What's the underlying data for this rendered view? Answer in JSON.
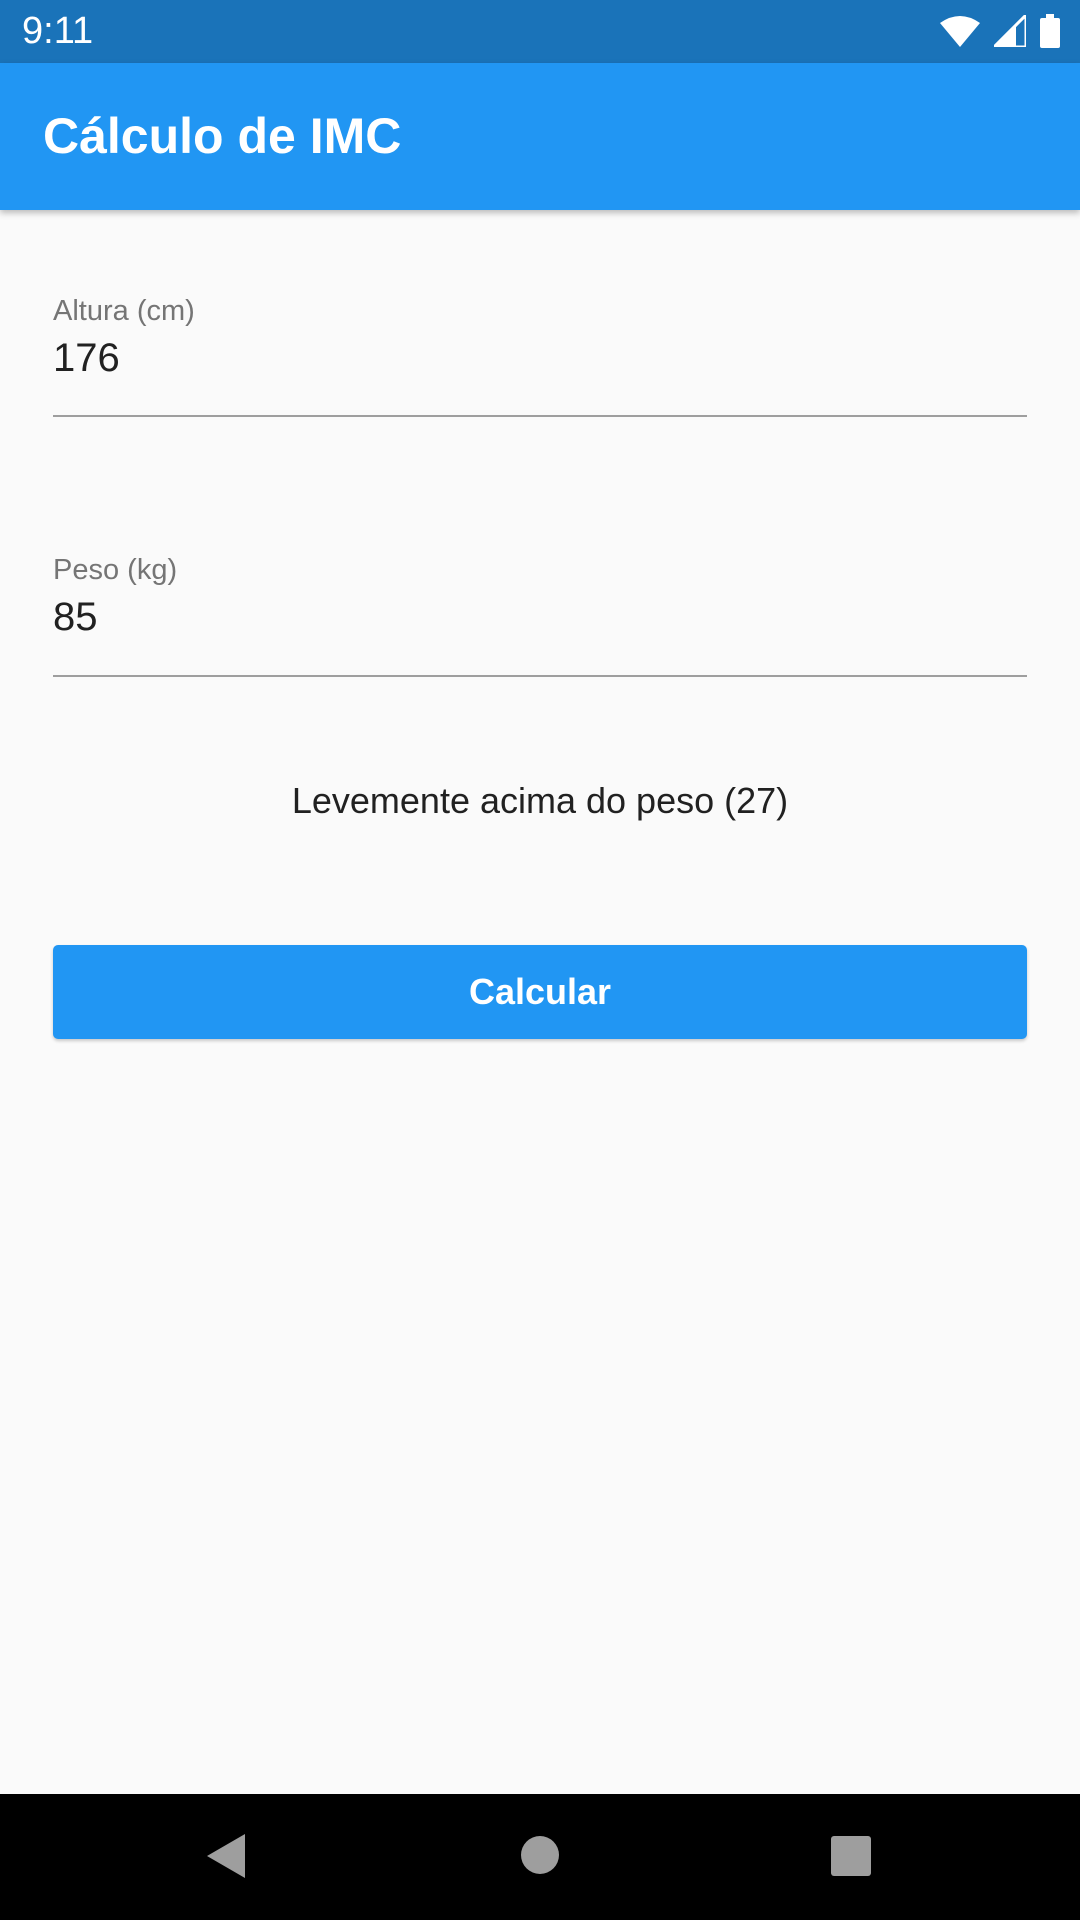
{
  "status_bar": {
    "time": "9:11"
  },
  "app_bar": {
    "title": "Cálculo de IMC"
  },
  "form": {
    "height_label": "Altura (cm)",
    "height_value": "176",
    "weight_label": "Peso (kg)",
    "weight_value": "85"
  },
  "result": "Levemente acima do peso (27)",
  "button": {
    "label": "Calcular"
  },
  "colors": {
    "primary": "#2196f3",
    "status_bar": "#1a73b9"
  }
}
